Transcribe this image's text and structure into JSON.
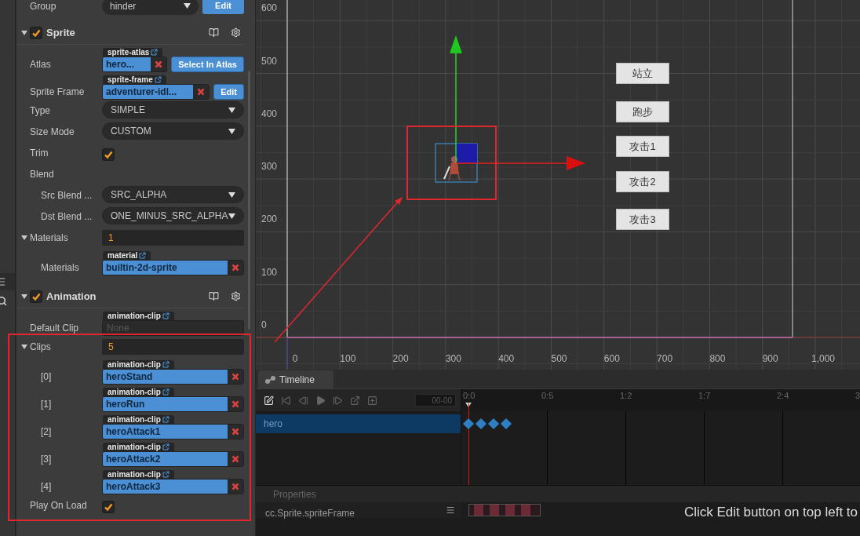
{
  "inspector": {
    "group_row": {
      "label": "Group",
      "value": "hinder",
      "button": "Edit"
    },
    "components": [
      {
        "title": "Sprite",
        "enabled": true,
        "expanded": true,
        "properties": [
          {
            "kind": "asset",
            "label": "Atlas",
            "asset_type": "sprite-atlas",
            "value": "hero...",
            "button": "Select In Atlas"
          },
          {
            "kind": "asset",
            "label": "Sprite Frame",
            "asset_type": "sprite-frame",
            "value": "adventurer-idl...",
            "button": "Edit"
          },
          {
            "kind": "select",
            "label": "Type",
            "value": "SIMPLE"
          },
          {
            "kind": "select",
            "label": "Size Mode",
            "value": "CUSTOM"
          },
          {
            "kind": "checkbox",
            "label": "Trim",
            "checked": true
          },
          {
            "kind": "group",
            "label": "Blend",
            "children": [
              {
                "kind": "select",
                "label": "Src Blend ...",
                "value": "SRC_ALPHA"
              },
              {
                "kind": "select",
                "label": "Dst Blend ...",
                "value": "ONE_MINUS_SRC_ALPHA"
              }
            ]
          },
          {
            "kind": "array",
            "label": "Materials",
            "count": "1",
            "expanded": true,
            "children": [
              {
                "kind": "asset",
                "label": "Materials",
                "asset_type": "material",
                "value": "builtin-2d-sprite"
              }
            ]
          }
        ]
      },
      {
        "title": "Animation",
        "enabled": true,
        "expanded": true,
        "properties": [
          {
            "kind": "asset",
            "label": "Default Clip",
            "asset_type": "animation-clip",
            "placeholder": "None"
          },
          {
            "kind": "array",
            "label": "Clips",
            "count": "5",
            "expanded": true,
            "children": [
              {
                "kind": "asset",
                "label": "[0]",
                "asset_type": "animation-clip",
                "value": "heroStand"
              },
              {
                "kind": "asset",
                "label": "[1]",
                "asset_type": "animation-clip",
                "value": "heroRun"
              },
              {
                "kind": "asset",
                "label": "[2]",
                "asset_type": "animation-clip",
                "value": "heroAttack1"
              },
              {
                "kind": "asset",
                "label": "[3]",
                "asset_type": "animation-clip",
                "value": "heroAttack2"
              },
              {
                "kind": "asset",
                "label": "[4]",
                "asset_type": "animation-clip",
                "value": "heroAttack3"
              }
            ]
          },
          {
            "kind": "checkbox",
            "label": "Play On Load",
            "checked": true
          }
        ]
      }
    ]
  },
  "scene": {
    "y_labels": [
      "600",
      "500",
      "400",
      "300",
      "200",
      "100",
      "0"
    ],
    "x_labels": [
      "0",
      "100",
      "200",
      "300",
      "400",
      "500",
      "600",
      "700",
      "800",
      "900",
      "1,000"
    ],
    "buttons": [
      "站立",
      "跑步",
      "攻击1",
      "攻击2",
      "攻击3"
    ]
  },
  "timeline": {
    "tab": "Timeline",
    "time_value": "00-00",
    "ruler_labels": [
      "0:0",
      "0:5",
      "1:2",
      "1:7",
      "2:4",
      "3"
    ],
    "nodes": [
      {
        "name": "hero",
        "selected": true
      }
    ],
    "properties_header": "Properties",
    "property_tracks": [
      {
        "name": "cc.Sprite.spriteFrame"
      }
    ],
    "hint": "Click Edit button on top left to"
  }
}
